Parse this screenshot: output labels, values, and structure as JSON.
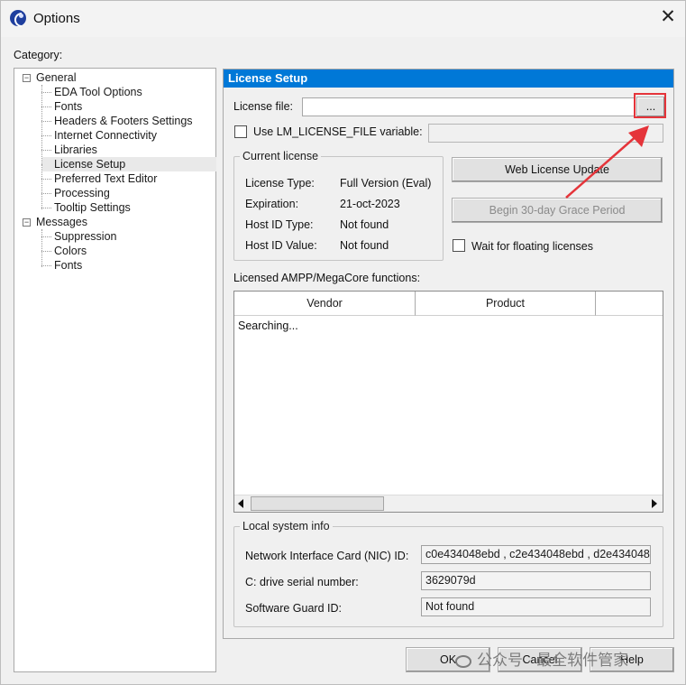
{
  "window": {
    "title": "Options",
    "close_glyph": "✕",
    "app_icon": "quartus-logo-icon"
  },
  "category": {
    "label": "Category:",
    "tree": [
      {
        "label": "General",
        "expander": "−"
      },
      {
        "label": "EDA Tool Options"
      },
      {
        "label": "Fonts"
      },
      {
        "label": "Headers & Footers Settings"
      },
      {
        "label": "Internet Connectivity"
      },
      {
        "label": "Libraries"
      },
      {
        "label": "License Setup",
        "selected": true
      },
      {
        "label": "Preferred Text Editor"
      },
      {
        "label": "Processing"
      },
      {
        "label": "Tooltip Settings"
      },
      {
        "label": "Messages",
        "expander": "−"
      },
      {
        "label": "Suppression"
      },
      {
        "label": "Colors"
      },
      {
        "label": "Fonts"
      }
    ]
  },
  "panel": {
    "header": "License Setup",
    "license_file": {
      "label": "License file:",
      "value": "",
      "browse_label": "..."
    },
    "lm_license": {
      "label": "Use LM_LICENSE_FILE variable:",
      "value": "",
      "checked": false
    },
    "current_license": {
      "title": "Current license",
      "rows": [
        {
          "key": "License Type:",
          "value": "Full Version (Eval)"
        },
        {
          "key": "Expiration:",
          "value": "21-oct-2023"
        },
        {
          "key": "Host ID Type:",
          "value": "Not found"
        },
        {
          "key": "Host ID Value:",
          "value": "Not found"
        }
      ]
    },
    "web_license_update": "Web License Update",
    "grace_period": "Begin 30-day Grace Period",
    "wait_floating": {
      "label": "Wait for floating licenses",
      "checked": false
    },
    "ampp": {
      "label": "Licensed AMPP/MegaCore functions:",
      "columns": [
        "Vendor",
        "Product"
      ],
      "status": "Searching..."
    },
    "local_system": {
      "title": "Local system info",
      "rows": [
        {
          "key": "Network Interface Card (NIC) ID:",
          "value": "c0e434048ebd , c2e434048ebd , d2e434048"
        },
        {
          "key": "C: drive serial number:",
          "value": "3629079d"
        },
        {
          "key": "Software Guard ID:",
          "value": "Not found"
        }
      ]
    }
  },
  "footer": {
    "ok": "OK",
    "cancel": "Cancel",
    "help": "Help"
  },
  "watermark": "公众号 · 最全软件管家",
  "colors": {
    "accent": "#0078d7",
    "annotation": "#e5343a"
  }
}
